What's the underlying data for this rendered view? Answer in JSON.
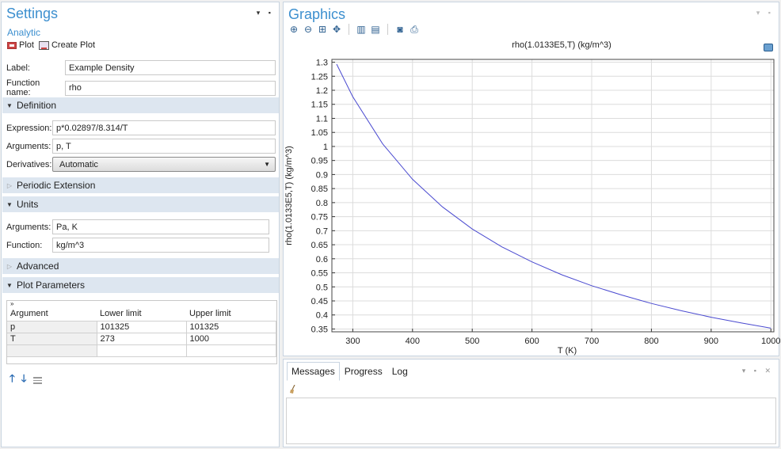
{
  "settings": {
    "title": "Settings",
    "subtitle": "Analytic",
    "toolbar": {
      "plot_label": "Plot",
      "create_plot_label": "Create Plot"
    },
    "label_field": {
      "label": "Label:",
      "value": "Example Density"
    },
    "function_name_field": {
      "label": "Function name:",
      "value": "rho"
    },
    "sections": {
      "definition": "Definition",
      "periodic_extension": "Periodic Extension",
      "units": "Units",
      "advanced": "Advanced",
      "plot_parameters": "Plot Parameters"
    },
    "definition": {
      "expression_label": "Expression:",
      "expression_value": "p*0.02897/8.314/T",
      "arguments_label": "Arguments:",
      "arguments_value": "p, T",
      "derivatives_label": "Derivatives:",
      "derivatives_value": "Automatic"
    },
    "units": {
      "arguments_label": "Arguments:",
      "arguments_value": "Pa, K",
      "function_label": "Function:",
      "function_value": "kg/m^3"
    },
    "plot_parameters": {
      "columns": [
        "Argument",
        "Lower limit",
        "Upper limit"
      ],
      "rows": [
        [
          "p",
          "101325",
          "101325"
        ],
        [
          "T",
          "273",
          "1000"
        ]
      ]
    }
  },
  "graphics": {
    "title": "Graphics",
    "icons": [
      "zoom-in-icon",
      "zoom-out-icon",
      "zoom-box-icon",
      "zoom-extents-icon",
      "grid-icon",
      "table-icon",
      "camera-icon",
      "print-icon"
    ]
  },
  "messages": {
    "tabs": [
      "Messages",
      "Progress",
      "Log"
    ],
    "active_tab": "Messages"
  },
  "chart_data": {
    "type": "line",
    "title": "rho(1.0133E5,T) (kg/m^3)",
    "xlabel": "T (K)",
    "ylabel": "rho(1.0133E5,T) (kg/m^3)",
    "xlim": [
      265,
      1005
    ],
    "ylim": [
      0.34,
      1.31
    ],
    "xticks": [
      300,
      400,
      500,
      600,
      700,
      800,
      900,
      1000
    ],
    "yticks": [
      0.35,
      0.4,
      0.45,
      0.5,
      0.55,
      0.6,
      0.65,
      0.7,
      0.75,
      0.8,
      0.85,
      0.9,
      0.95,
      1,
      1.05,
      1.1,
      1.15,
      1.2,
      1.25,
      1.3
    ],
    "grid": true,
    "series": [
      {
        "color": "#4a4ad0",
        "x": [
          273,
          300,
          350,
          400,
          450,
          500,
          550,
          600,
          650,
          700,
          750,
          800,
          850,
          900,
          950,
          1000
        ],
        "y": [
          1.293,
          1.177,
          1.009,
          0.883,
          0.785,
          0.706,
          0.642,
          0.589,
          0.543,
          0.504,
          0.471,
          0.441,
          0.415,
          0.392,
          0.372,
          0.353
        ]
      }
    ]
  }
}
